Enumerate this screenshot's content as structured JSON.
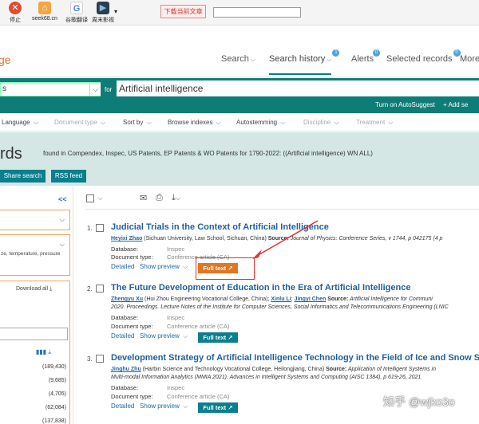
{
  "browser": {
    "stop_label": "停止",
    "seek_label": "seek68.cn",
    "translate_label": "谷歌翻译",
    "movie_label": "周末影视",
    "more": "▾",
    "download_button": "下载当前文章",
    "stop_glyph": "✕",
    "seek_glyph": "⌂",
    "translate_glyph": "G",
    "movie_glyph": "▶"
  },
  "nav": {
    "logo": "ge",
    "search": "Search",
    "history": "Search history",
    "history_badge": "1",
    "alerts": "Alerts",
    "alerts_badge": "0",
    "selected": "Selected records",
    "selected_badge": "0",
    "more": "More"
  },
  "searchbar": {
    "field": "s",
    "for": "for",
    "query": "Artificial intelligence",
    "autosuggest": "Turn on AutoSuggest",
    "add_search": "+ Add se"
  },
  "options": [
    {
      "label": "Language",
      "disabled": false
    },
    {
      "label": "Document type",
      "disabled": true
    },
    {
      "label": "Sort by",
      "disabled": false
    },
    {
      "label": "Browse indexes",
      "disabled": false
    },
    {
      "label": "Autostemming",
      "disabled": false
    },
    {
      "label": "Discipline",
      "disabled": true
    },
    {
      "label": "Treatment",
      "disabled": true
    }
  ],
  "banner": {
    "big": "rds",
    "text": "found in Compendex, Inspec, US Patents, EP Patents & WO Patents for 1790-2022: ((Artificial intelligence) WN ALL)",
    "share": "Share search",
    "rss": "RSS feed"
  },
  "sidebar": {
    "collapse": "<<",
    "facet2_text": "ze, temperature, pressure",
    "download_all": "Download all",
    "counts": [
      "(189,430)",
      "(9,685)",
      "(4,705)",
      "(62,084)",
      "(137,838)"
    ]
  },
  "results": [
    {
      "num": "1.",
      "title": "Judicial Trials in the Context of Artificial Intelligence",
      "author": "Heyixi Zhao",
      "affil": " (Sichuan University, Law School, Sichuan, China) ",
      "source_label": "Source:",
      "source": " Journal of Physics: Conference Series, v 1744, p 042175 (4 p",
      "source2": "",
      "db_label": "Database:",
      "db": "Inspec",
      "dt_label": "Document type:",
      "dt": "Conference article (CA)",
      "detailed": "Detailed",
      "preview": "Show preview",
      "fulltext": "Full text",
      "btn_color": "orange"
    },
    {
      "num": "2.",
      "title": "The Future Development of Education in the Era of Artificial Intelligence",
      "author": "Zhengyu Xu",
      "affil": " (Hui Zhou Engineering Vocational College, China); ",
      "author2": "Xinlu Li",
      "sep": "; ",
      "author3": "Jingyi Chen",
      "source_label": " Source:",
      "source": " Artificial Intelligence for Communi",
      "source2": "2020. Proceedings. Lecture Notes of the Institute for Computer Sciences, Social Informatics and Telecommunications Engineering (LNIC",
      "db_label": "Database:",
      "db": "Inspec",
      "dt_label": "Document type:",
      "dt": "Conference article (CA)",
      "detailed": "Detailed",
      "preview": "Show preview",
      "fulltext": "Full text",
      "btn_color": "teal"
    },
    {
      "num": "3.",
      "title": "Development Strategy of Artificial Intelligence Technology in the Field of Ice and Snow Sports",
      "author": "Jinghu Zhu",
      "affil": " (Harbin Science and Technology Vocational College, Heilongjiang, China) ",
      "source_label": "Source:",
      "source": " Application of Intelligent Systems in",
      "source2": "Multi-modal Information Analytics (MMIA 2021). Advances in Intelligent Systems and Computing (AISC 1384), p 619-26, 2021",
      "db_label": "Database:",
      "db": "Inspec",
      "dt_label": "Document type:",
      "dt": "Conference article (CA)",
      "detailed": "Detailed",
      "preview": "Show preview",
      "fulltext": "Full text",
      "btn_color": "teal"
    }
  ],
  "watermark": "知乎 @wjko3o",
  "colors": {
    "teal": "#0f7d77",
    "button_teal": "#0b7f8e",
    "orange": "#e3761f",
    "link": "#1f5f9e",
    "highlight": "#d9352f"
  }
}
